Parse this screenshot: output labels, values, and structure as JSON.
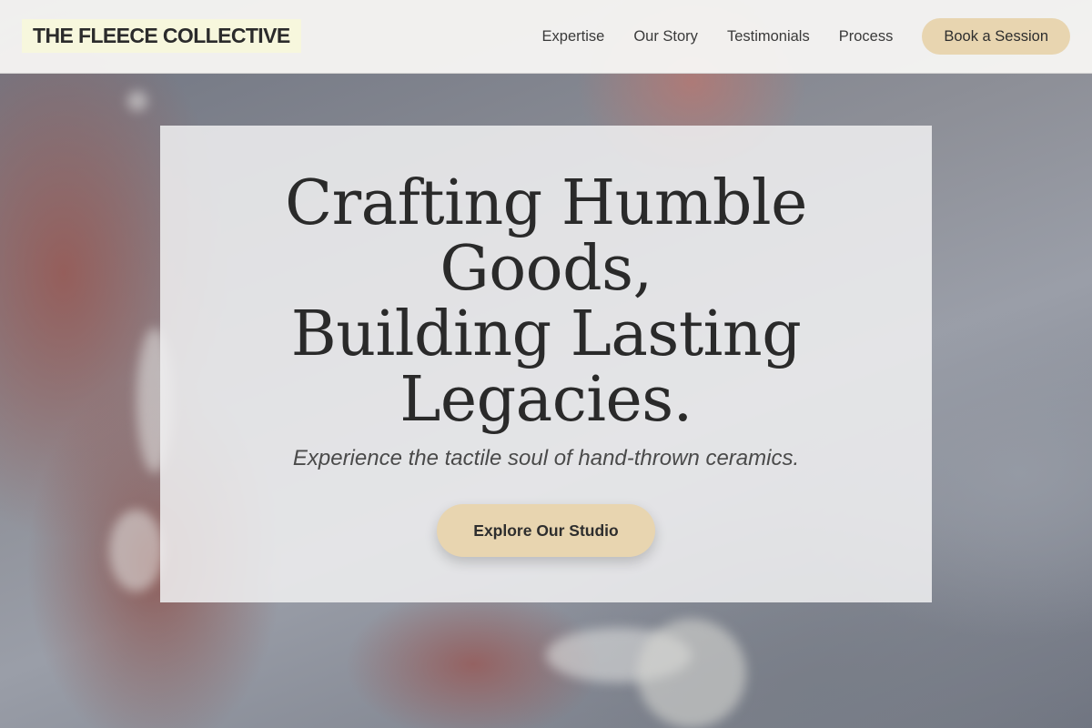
{
  "brand": {
    "name": "THE FLEECE COLLECTIVE"
  },
  "nav": {
    "links": [
      "Expertise",
      "Our Story",
      "Testimonials",
      "Process"
    ],
    "cta_label": "Book a Session"
  },
  "hero": {
    "title_lines": [
      "Crafting Humble",
      "Goods,",
      "Building Lasting",
      "Legacies."
    ],
    "subtitle": "Experience the tactile soul of hand-thrown ceramics.",
    "cta_label": "Explore Our Studio"
  },
  "colors": {
    "accent": "#e8d5b0",
    "brand_highlight": "#f7f7dd",
    "text": "#2a2a2a",
    "nav_background": "#f6f5f3"
  }
}
